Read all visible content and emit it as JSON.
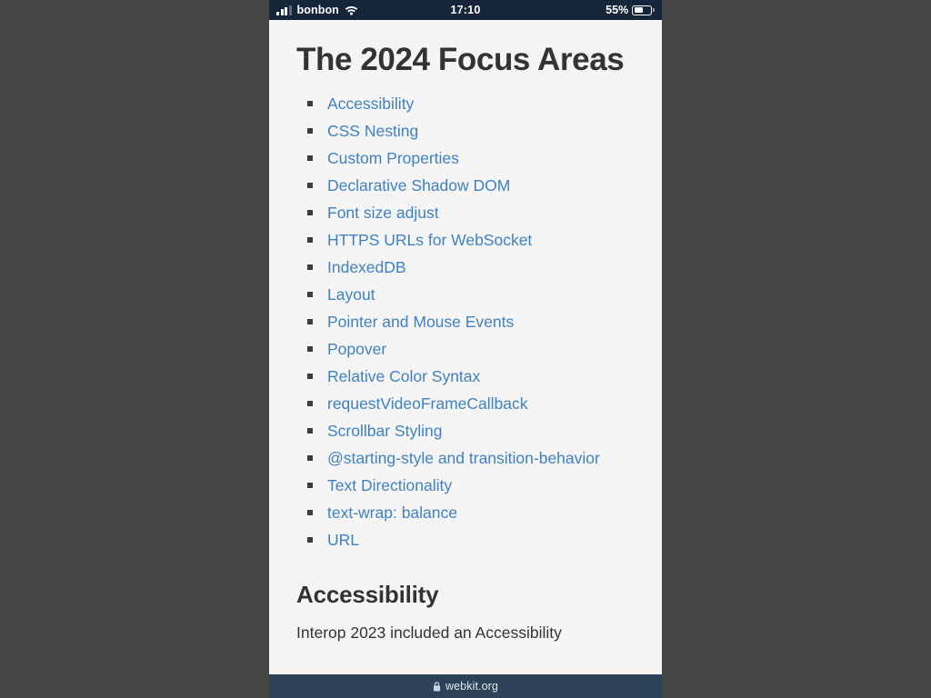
{
  "status_bar": {
    "signal_icon": "cellular-signal-icon",
    "carrier": "bonbon",
    "wifi_icon": "wifi-icon",
    "time": "17:10",
    "battery_percent": "55%",
    "battery_level_value": 55,
    "battery_icon": "battery-icon"
  },
  "page": {
    "title": "The 2024 Focus Areas",
    "focus_areas": [
      "Accessibility",
      "CSS Nesting",
      "Custom Properties",
      "Declarative Shadow DOM",
      "Font size adjust",
      "HTTPS URLs for WebSocket",
      "IndexedDB",
      "Layout",
      "Pointer and Mouse Events",
      "Popover",
      "Relative Color Syntax",
      "requestVideoFrameCallback",
      "Scrollbar Styling",
      "@starting-style and transition-behavior",
      "Text Directionality",
      "text-wrap: balance",
      "URL"
    ],
    "section_heading": "Accessibility",
    "section_paragraph": "Interop 2023 included an Accessibility"
  },
  "url_bar": {
    "lock_icon": "lock-icon",
    "url": "webkit.org"
  },
  "colors": {
    "status_bar_background": "#16263A",
    "url_bar_background": "#2C4257",
    "page_background": "#F5F5F5",
    "outer_background": "#454544",
    "link_blue": "#3F81C1",
    "text_dark": "#333333",
    "bullet_dark": "#3C3C3C"
  }
}
